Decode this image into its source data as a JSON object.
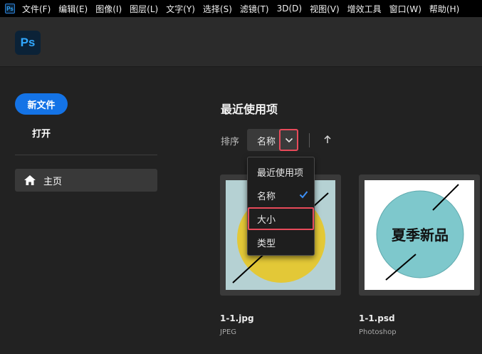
{
  "menubar": {
    "app_icon": "Ps",
    "items": [
      "文件(F)",
      "编辑(E)",
      "图像(I)",
      "图层(L)",
      "文字(Y)",
      "选择(S)",
      "滤镜(T)",
      "3D(D)",
      "视图(V)",
      "增效工具",
      "窗口(W)",
      "帮助(H)"
    ]
  },
  "header": {
    "logo_text": "Ps"
  },
  "sidebar": {
    "new_file_label": "新文件",
    "open_label": "打开",
    "home_label": "主页"
  },
  "main": {
    "section_title": "最近使用项",
    "sort_label": "排序",
    "sort_value": "名称"
  },
  "dropdown": {
    "items": [
      {
        "label": "最近使用项"
      },
      {
        "label": "名称",
        "checked": true
      },
      {
        "label": "大小",
        "highlighted": true
      },
      {
        "label": "类型"
      }
    ]
  },
  "files": [
    {
      "name": "1-1.jpg",
      "type": "JPEG"
    },
    {
      "name": "1-1.psd",
      "type": "Photoshop",
      "thumb_text": "夏季新品"
    }
  ],
  "colors": {
    "accent": "#1473e6",
    "highlight_outline": "#e84a5a",
    "thumb1_bg": "#b5d1d3",
    "thumb1_circle": "#e3c837",
    "thumb2_circle": "#7ec8cc"
  }
}
